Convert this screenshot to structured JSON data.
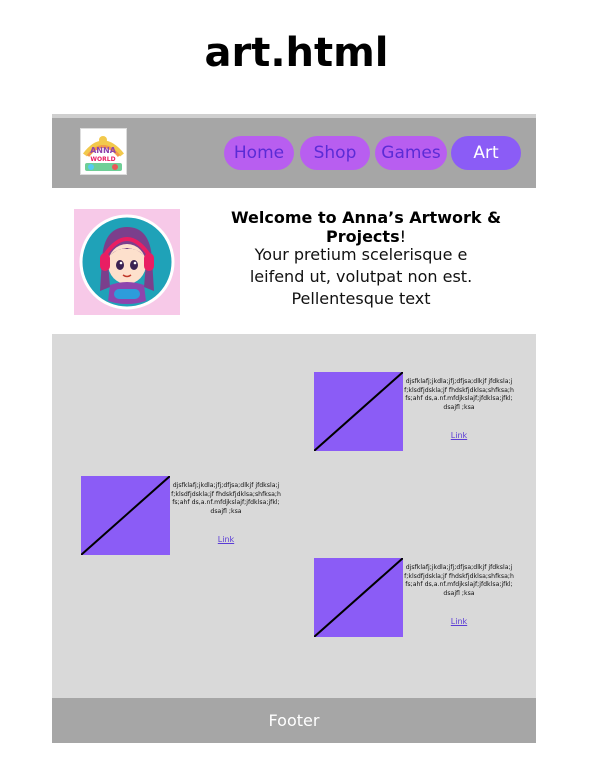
{
  "doc_title": "art.html",
  "nav": {
    "logo_icon": "anna-world-logo",
    "items": [
      {
        "label": "Home",
        "active": false
      },
      {
        "label": "Shop",
        "active": false
      },
      {
        "label": "Games",
        "active": false
      },
      {
        "label": "Art",
        "active": true
      }
    ],
    "button_color": "#b85ef0",
    "active_color": "#8b5cf6"
  },
  "hero": {
    "avatar_icon": "girl-gamer-headphones-avatar",
    "welcome_bold": "Welcome to Anna’s Artwork & Projects",
    "welcome_suffix": "!",
    "intro": "Your pretium scelerisque e leifend ut, volutpat non est. Pellentesque text"
  },
  "gallery": {
    "background": "#d9d9d9",
    "thumb_color": "#8b5cf6",
    "cards": [
      {
        "text": "djsfklafj;jkdla;jfj;dfjsa;dlkjf jfdksla;jf;klsdfjdskla;jf fhdskfjdklsa;shfksa;hfs;ahf ds,a.nf.mfdjkslajf;jfdklsa;jfkl;dsajfl ;ksa",
        "link": "Link"
      },
      {
        "text": "djsfklafj;jkdla;jfj;dfjsa;dlkjf jfdksla;jf;klsdfjdskla;jf fhdskfjdklsa;shfksa;hfs;ahf ds,a.nf.mfdjkslajf;jfdklsa;jfkl;dsajfl ;ksa",
        "link": "Link"
      },
      {
        "text": "djsfklafj;jkdla;jfj;dfjsa;dlkjf jfdksla;jf;klsdfjdskla;jf fhdskfjdklsa;shfksa;hfs;ahf ds,a.nf.mfdjkslajf;jfdklsa;jfkl;dsajfl ;ksa",
        "link": "Link"
      }
    ]
  },
  "footer": {
    "label": "Footer"
  }
}
